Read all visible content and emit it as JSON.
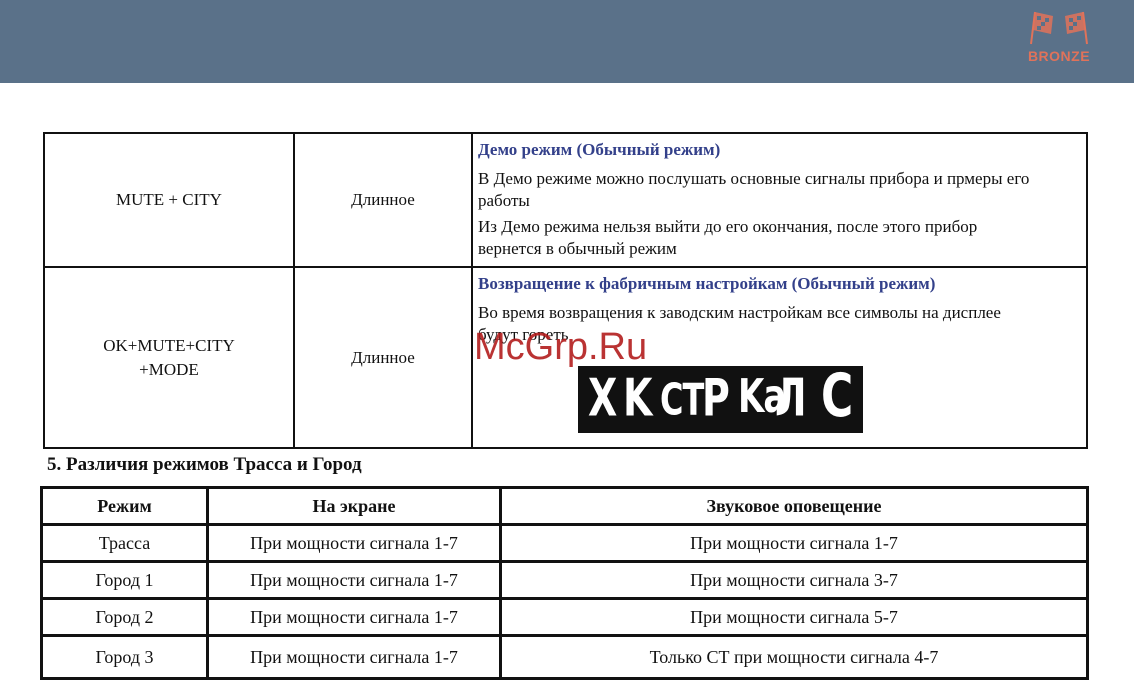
{
  "header": {
    "brand": "BRONZE",
    "brand_color": "#e0725a",
    "bar_color": "#5a7189"
  },
  "table1": {
    "rows": [
      {
        "buttons": "MUTE + CITY",
        "press": "Длинное",
        "title": "Демо режим (Обычный режим)",
        "lines": [
          "В Демо режиме можно послушать основные сигналы прибора и прмеры его работы",
          "Из Демо режима нельзя выйти до его окончания, после этого прибор вернется в обычный режим"
        ]
      },
      {
        "buttons_line1": "OK+MUTE+CITY",
        "buttons_line2": "+MODE",
        "press": "Длинное",
        "title": "Возвращение к фабричным настройкам (Обычный режим)",
        "lines": [
          "Во время возвращения к заводским настройкам все символы на дисплее будут гореть"
        ],
        "display_text": "X K CT P KaЛ C"
      }
    ]
  },
  "watermark": "McGrp.Ru",
  "section": {
    "title": "5. Различия режимов Трасса и Город"
  },
  "table2": {
    "headers": [
      "Режим",
      "На экране",
      "Звуковое оповещение"
    ],
    "rows": [
      [
        "Трасса",
        "При мощности сигнала 1-7",
        "При мощности сигнала 1-7"
      ],
      [
        "Город 1",
        "При мощности сигнала 1-7",
        "При мощности сигнала 3-7"
      ],
      [
        "Город 2",
        "При мощности сигнала 1-7",
        "При мощности сигнала 5-7"
      ],
      [
        "Город 3",
        "При мощности сигнала 1-7",
        "Только СТ при мощности сигнала 4-7"
      ]
    ]
  }
}
